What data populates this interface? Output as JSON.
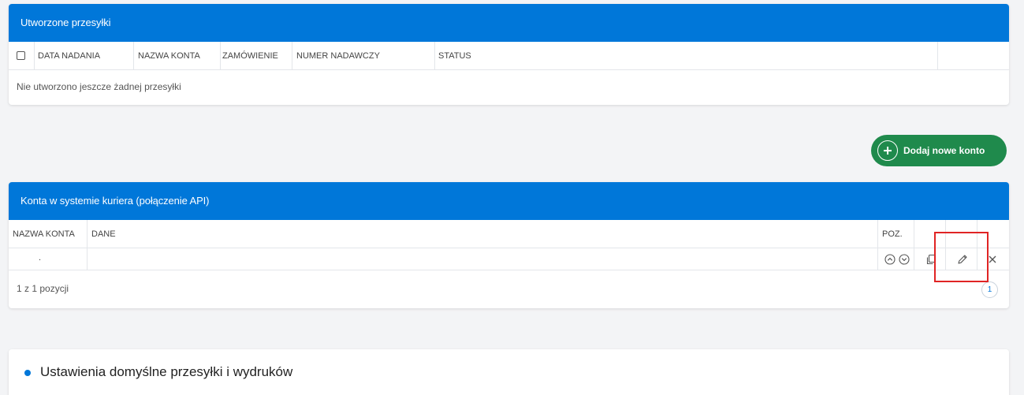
{
  "shipments_panel": {
    "title": "Utworzone przesyłki",
    "columns": [
      "DATA NADANIA",
      "NAZWA KONTA",
      "ZAMÓWIENIE",
      "NUMER NADAWCZY",
      "STATUS"
    ],
    "empty_message": "Nie utworzono jeszcze żadnej przesyłki"
  },
  "add_account_button": {
    "label": "Dodaj nowe konto"
  },
  "accounts_panel": {
    "title": "Konta w systemie kuriera (połączenie API)",
    "columns": [
      "NAZWA KONTA",
      "DANE",
      "POZ."
    ],
    "rows": [
      {
        "account_name": ".",
        "data": ""
      }
    ],
    "count_text": "1 z 1 pozycji",
    "page": "1"
  },
  "defaults_section": {
    "title": "Ustawienia domyślne przesyłki i wydruków"
  },
  "colors": {
    "header_blue": "#0077d9",
    "button_green": "#1f8a4c",
    "highlight_red": "#e02424"
  },
  "icons": [
    "plus-icon",
    "arrow-up-icon",
    "arrow-down-icon",
    "copy-icon",
    "pencil-icon",
    "close-icon"
  ]
}
